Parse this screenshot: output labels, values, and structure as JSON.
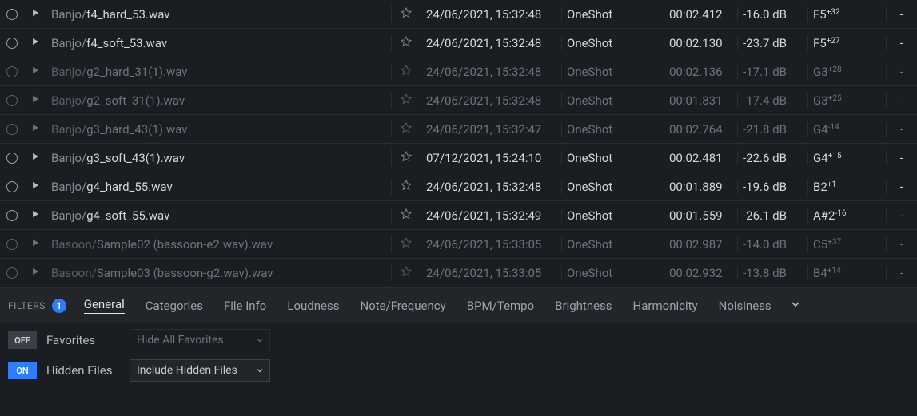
{
  "rows": [
    {
      "bright": true,
      "folder": "Banjo/",
      "file": "f4_hard_53.wav",
      "date": "24/06/2021, 15:32:48",
      "type": "OneShot",
      "dur": "00:02.412",
      "loud": "-16.0 dB",
      "note": "F5",
      "cents": "+32",
      "last": "-"
    },
    {
      "bright": true,
      "folder": "Banjo/",
      "file": "f4_soft_53.wav",
      "date": "24/06/2021, 15:32:48",
      "type": "OneShot",
      "dur": "00:02.130",
      "loud": "-23.7 dB",
      "note": "F5",
      "cents": "+27",
      "last": "-"
    },
    {
      "bright": false,
      "folder": "Banjo/",
      "file": "g2_hard_31(1).wav",
      "date": "24/06/2021, 15:32:48",
      "type": "OneShot",
      "dur": "00:02.136",
      "loud": "-17.1 dB",
      "note": "G3",
      "cents": "+28",
      "last": "-"
    },
    {
      "bright": false,
      "folder": "Banjo/",
      "file": "g2_soft_31(1).wav",
      "date": "24/06/2021, 15:32:48",
      "type": "OneShot",
      "dur": "00:01.831",
      "loud": "-17.4 dB",
      "note": "G3",
      "cents": "+25",
      "last": "-"
    },
    {
      "bright": false,
      "folder": "Banjo/",
      "file": "g3_hard_43(1).wav",
      "date": "24/06/2021, 15:32:47",
      "type": "OneShot",
      "dur": "00:02.764",
      "loud": "-21.8 dB",
      "note": "G4",
      "cents": "-14",
      "last": "-"
    },
    {
      "bright": true,
      "folder": "Banjo/",
      "file": "g3_soft_43(1).wav",
      "date": "07/12/2021, 15:24:10",
      "type": "OneShot",
      "dur": "00:02.481",
      "loud": "-22.6 dB",
      "note": "G4",
      "cents": "+15",
      "last": "-"
    },
    {
      "bright": true,
      "folder": "Banjo/",
      "file": "g4_hard_55.wav",
      "date": "24/06/2021, 15:32:48",
      "type": "OneShot",
      "dur": "00:01.889",
      "loud": "-19.6 dB",
      "note": "B2",
      "cents": "+1",
      "last": "-"
    },
    {
      "bright": true,
      "folder": "Banjo/",
      "file": "g4_soft_55.wav",
      "date": "24/06/2021, 15:32:49",
      "type": "OneShot",
      "dur": "00:01.559",
      "loud": "-26.1 dB",
      "note": "A#2",
      "cents": "-16",
      "last": "-"
    },
    {
      "bright": false,
      "folder": "Basoon/",
      "file": "Sample02 (bassoon-e2.wav).wav",
      "date": "24/06/2021, 15:33:05",
      "type": "OneShot",
      "dur": "00:02.987",
      "loud": "-14.0 dB",
      "note": "C5",
      "cents": "+37",
      "last": "-"
    },
    {
      "bright": false,
      "folder": "Basoon/",
      "file": "Sample03 (bassoon-g2.wav).wav",
      "date": "24/06/2021, 15:33:05",
      "type": "OneShot",
      "dur": "00:02.932",
      "loud": "-13.8 dB",
      "note": "B4",
      "cents": "+14",
      "last": "-"
    }
  ],
  "filters": {
    "label": "FILTERS",
    "count": "1",
    "tabs": [
      "General",
      "Categories",
      "File Info",
      "Loudness",
      "Note/Frequency",
      "BPM/Tempo",
      "Brightness",
      "Harmonicity",
      "Noisiness"
    ],
    "active_tab": 0
  },
  "controls": {
    "favorites": {
      "toggle": "OFF",
      "label": "Favorites",
      "select": "Hide All Favorites"
    },
    "hidden": {
      "toggle": "ON",
      "label": "Hidden Files",
      "select": "Include Hidden Files"
    }
  }
}
